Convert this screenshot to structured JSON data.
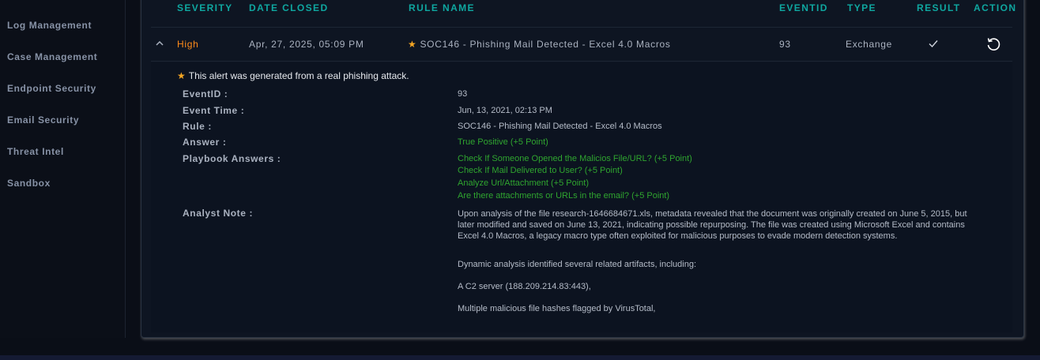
{
  "sidebar": {
    "items": [
      {
        "label": "Log Management"
      },
      {
        "label": "Case Management"
      },
      {
        "label": "Endpoint Security"
      },
      {
        "label": "Email Security"
      },
      {
        "label": "Threat Intel"
      },
      {
        "label": "Sandbox"
      }
    ]
  },
  "table": {
    "headers": {
      "severity": "SEVERITY",
      "date_closed": "DATE CLOSED",
      "rule_name": "RULE NAME",
      "event_id": "EVENTID",
      "type": "TYPE",
      "result": "RESULT",
      "action": "ACTION"
    },
    "row": {
      "severity": "High",
      "date_closed": "Apr, 27, 2025, 05:09 PM",
      "rule_name": "SOC146 - Phishing Mail Detected - Excel 4.0 Macros",
      "event_id": "93",
      "type": "Exchange",
      "severity_color": "#ff8c1a"
    }
  },
  "details": {
    "banner": "This alert was generated from a real phishing attack.",
    "labels": {
      "event_id": "EventID :",
      "event_time": "Event Time :",
      "rule": "Rule :",
      "answer": "Answer :",
      "playbook": "Playbook Answers :",
      "analyst_note": "Analyst Note :"
    },
    "values": {
      "event_id": "93",
      "event_time": "Jun, 13, 2021, 02:13 PM",
      "rule": "SOC146 - Phishing Mail Detected - Excel 4.0 Macros",
      "answer": "True Positive (+5 Point)"
    },
    "playbook_answers": [
      "Check If Someone Opened the Malicios File/URL? (+5 Point)",
      "Check If Mail Delivered to User? (+5 Point)",
      "Analyze Url/Attachment (+5 Point)",
      "Are there attachments or URLs in the email? (+5 Point)"
    ],
    "analyst_note": [
      "Upon analysis of the file research-1646684671.xls, metadata revealed that the document was originally created on June 5, 2015, but later modified and saved on June 13, 2021, indicating possible repurposing. The file was created using Microsoft Excel and contains Excel 4.0 Macros, a legacy macro type often exploited for malicious purposes to evade modern detection systems.",
      "Dynamic analysis identified several related artifacts, including:",
      "A C2 server (188.209.214.83:443),",
      "Multiple malicious file hashes flagged by VirusTotal,"
    ]
  },
  "colors": {
    "accent": "#0fa7a0",
    "answer_green": "#2fa52f",
    "star": "#f5a623"
  }
}
